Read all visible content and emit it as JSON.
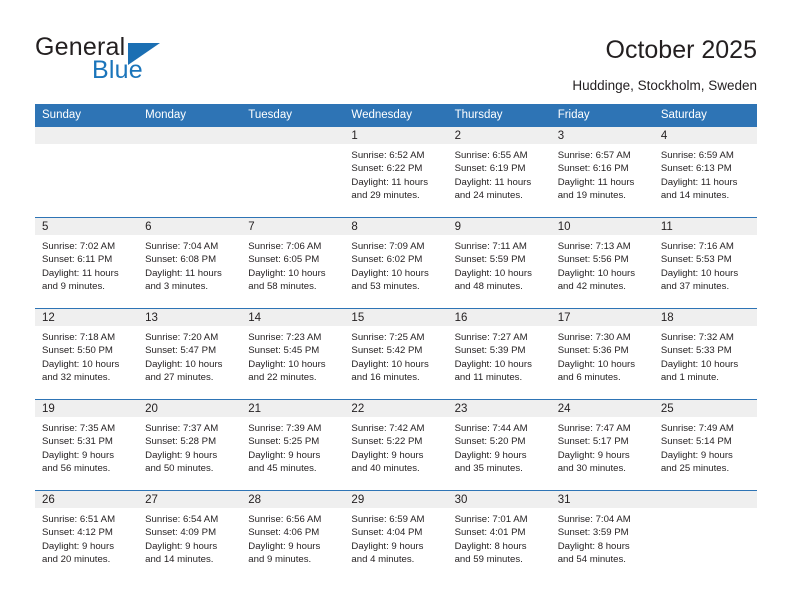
{
  "brand": {
    "name_top": "General",
    "name_bottom": "Blue",
    "triangle_icon": "triangle-icon",
    "color_blue": "#1b75bb",
    "color_dark": "#231f20"
  },
  "header": {
    "title": "October 2025",
    "subtitle": "Huddinge, Stockholm, Sweden"
  },
  "theme": {
    "header_blue": "#2e74b5",
    "daynum_band": "#efefef",
    "text": "#231f20"
  },
  "calendar": {
    "weekday_headers": [
      "Sunday",
      "Monday",
      "Tuesday",
      "Wednesday",
      "Thursday",
      "Friday",
      "Saturday"
    ],
    "labels": {
      "sunrise": "Sunrise:",
      "sunset": "Sunset:",
      "daylight": "Daylight:"
    },
    "weeks": [
      [
        {
          "day": "",
          "sunrise": "",
          "sunset": "",
          "daylight_1": "",
          "daylight_2": ""
        },
        {
          "day": "",
          "sunrise": "",
          "sunset": "",
          "daylight_1": "",
          "daylight_2": ""
        },
        {
          "day": "",
          "sunrise": "",
          "sunset": "",
          "daylight_1": "",
          "daylight_2": ""
        },
        {
          "day": "1",
          "sunrise": "Sunrise: 6:52 AM",
          "sunset": "Sunset: 6:22 PM",
          "daylight_1": "Daylight: 11 hours",
          "daylight_2": "and 29 minutes."
        },
        {
          "day": "2",
          "sunrise": "Sunrise: 6:55 AM",
          "sunset": "Sunset: 6:19 PM",
          "daylight_1": "Daylight: 11 hours",
          "daylight_2": "and 24 minutes."
        },
        {
          "day": "3",
          "sunrise": "Sunrise: 6:57 AM",
          "sunset": "Sunset: 6:16 PM",
          "daylight_1": "Daylight: 11 hours",
          "daylight_2": "and 19 minutes."
        },
        {
          "day": "4",
          "sunrise": "Sunrise: 6:59 AM",
          "sunset": "Sunset: 6:13 PM",
          "daylight_1": "Daylight: 11 hours",
          "daylight_2": "and 14 minutes."
        }
      ],
      [
        {
          "day": "5",
          "sunrise": "Sunrise: 7:02 AM",
          "sunset": "Sunset: 6:11 PM",
          "daylight_1": "Daylight: 11 hours",
          "daylight_2": "and 9 minutes."
        },
        {
          "day": "6",
          "sunrise": "Sunrise: 7:04 AM",
          "sunset": "Sunset: 6:08 PM",
          "daylight_1": "Daylight: 11 hours",
          "daylight_2": "and 3 minutes."
        },
        {
          "day": "7",
          "sunrise": "Sunrise: 7:06 AM",
          "sunset": "Sunset: 6:05 PM",
          "daylight_1": "Daylight: 10 hours",
          "daylight_2": "and 58 minutes."
        },
        {
          "day": "8",
          "sunrise": "Sunrise: 7:09 AM",
          "sunset": "Sunset: 6:02 PM",
          "daylight_1": "Daylight: 10 hours",
          "daylight_2": "and 53 minutes."
        },
        {
          "day": "9",
          "sunrise": "Sunrise: 7:11 AM",
          "sunset": "Sunset: 5:59 PM",
          "daylight_1": "Daylight: 10 hours",
          "daylight_2": "and 48 minutes."
        },
        {
          "day": "10",
          "sunrise": "Sunrise: 7:13 AM",
          "sunset": "Sunset: 5:56 PM",
          "daylight_1": "Daylight: 10 hours",
          "daylight_2": "and 42 minutes."
        },
        {
          "day": "11",
          "sunrise": "Sunrise: 7:16 AM",
          "sunset": "Sunset: 5:53 PM",
          "daylight_1": "Daylight: 10 hours",
          "daylight_2": "and 37 minutes."
        }
      ],
      [
        {
          "day": "12",
          "sunrise": "Sunrise: 7:18 AM",
          "sunset": "Sunset: 5:50 PM",
          "daylight_1": "Daylight: 10 hours",
          "daylight_2": "and 32 minutes."
        },
        {
          "day": "13",
          "sunrise": "Sunrise: 7:20 AM",
          "sunset": "Sunset: 5:47 PM",
          "daylight_1": "Daylight: 10 hours",
          "daylight_2": "and 27 minutes."
        },
        {
          "day": "14",
          "sunrise": "Sunrise: 7:23 AM",
          "sunset": "Sunset: 5:45 PM",
          "daylight_1": "Daylight: 10 hours",
          "daylight_2": "and 22 minutes."
        },
        {
          "day": "15",
          "sunrise": "Sunrise: 7:25 AM",
          "sunset": "Sunset: 5:42 PM",
          "daylight_1": "Daylight: 10 hours",
          "daylight_2": "and 16 minutes."
        },
        {
          "day": "16",
          "sunrise": "Sunrise: 7:27 AM",
          "sunset": "Sunset: 5:39 PM",
          "daylight_1": "Daylight: 10 hours",
          "daylight_2": "and 11 minutes."
        },
        {
          "day": "17",
          "sunrise": "Sunrise: 7:30 AM",
          "sunset": "Sunset: 5:36 PM",
          "daylight_1": "Daylight: 10 hours",
          "daylight_2": "and 6 minutes."
        },
        {
          "day": "18",
          "sunrise": "Sunrise: 7:32 AM",
          "sunset": "Sunset: 5:33 PM",
          "daylight_1": "Daylight: 10 hours",
          "daylight_2": "and 1 minute."
        }
      ],
      [
        {
          "day": "19",
          "sunrise": "Sunrise: 7:35 AM",
          "sunset": "Sunset: 5:31 PM",
          "daylight_1": "Daylight: 9 hours",
          "daylight_2": "and 56 minutes."
        },
        {
          "day": "20",
          "sunrise": "Sunrise: 7:37 AM",
          "sunset": "Sunset: 5:28 PM",
          "daylight_1": "Daylight: 9 hours",
          "daylight_2": "and 50 minutes."
        },
        {
          "day": "21",
          "sunrise": "Sunrise: 7:39 AM",
          "sunset": "Sunset: 5:25 PM",
          "daylight_1": "Daylight: 9 hours",
          "daylight_2": "and 45 minutes."
        },
        {
          "day": "22",
          "sunrise": "Sunrise: 7:42 AM",
          "sunset": "Sunset: 5:22 PM",
          "daylight_1": "Daylight: 9 hours",
          "daylight_2": "and 40 minutes."
        },
        {
          "day": "23",
          "sunrise": "Sunrise: 7:44 AM",
          "sunset": "Sunset: 5:20 PM",
          "daylight_1": "Daylight: 9 hours",
          "daylight_2": "and 35 minutes."
        },
        {
          "day": "24",
          "sunrise": "Sunrise: 7:47 AM",
          "sunset": "Sunset: 5:17 PM",
          "daylight_1": "Daylight: 9 hours",
          "daylight_2": "and 30 minutes."
        },
        {
          "day": "25",
          "sunrise": "Sunrise: 7:49 AM",
          "sunset": "Sunset: 5:14 PM",
          "daylight_1": "Daylight: 9 hours",
          "daylight_2": "and 25 minutes."
        }
      ],
      [
        {
          "day": "26",
          "sunrise": "Sunrise: 6:51 AM",
          "sunset": "Sunset: 4:12 PM",
          "daylight_1": "Daylight: 9 hours",
          "daylight_2": "and 20 minutes."
        },
        {
          "day": "27",
          "sunrise": "Sunrise: 6:54 AM",
          "sunset": "Sunset: 4:09 PM",
          "daylight_1": "Daylight: 9 hours",
          "daylight_2": "and 14 minutes."
        },
        {
          "day": "28",
          "sunrise": "Sunrise: 6:56 AM",
          "sunset": "Sunset: 4:06 PM",
          "daylight_1": "Daylight: 9 hours",
          "daylight_2": "and 9 minutes."
        },
        {
          "day": "29",
          "sunrise": "Sunrise: 6:59 AM",
          "sunset": "Sunset: 4:04 PM",
          "daylight_1": "Daylight: 9 hours",
          "daylight_2": "and 4 minutes."
        },
        {
          "day": "30",
          "sunrise": "Sunrise: 7:01 AM",
          "sunset": "Sunset: 4:01 PM",
          "daylight_1": "Daylight: 8 hours",
          "daylight_2": "and 59 minutes."
        },
        {
          "day": "31",
          "sunrise": "Sunrise: 7:04 AM",
          "sunset": "Sunset: 3:59 PM",
          "daylight_1": "Daylight: 8 hours",
          "daylight_2": "and 54 minutes."
        },
        {
          "day": "",
          "sunrise": "",
          "sunset": "",
          "daylight_1": "",
          "daylight_2": ""
        }
      ]
    ]
  }
}
